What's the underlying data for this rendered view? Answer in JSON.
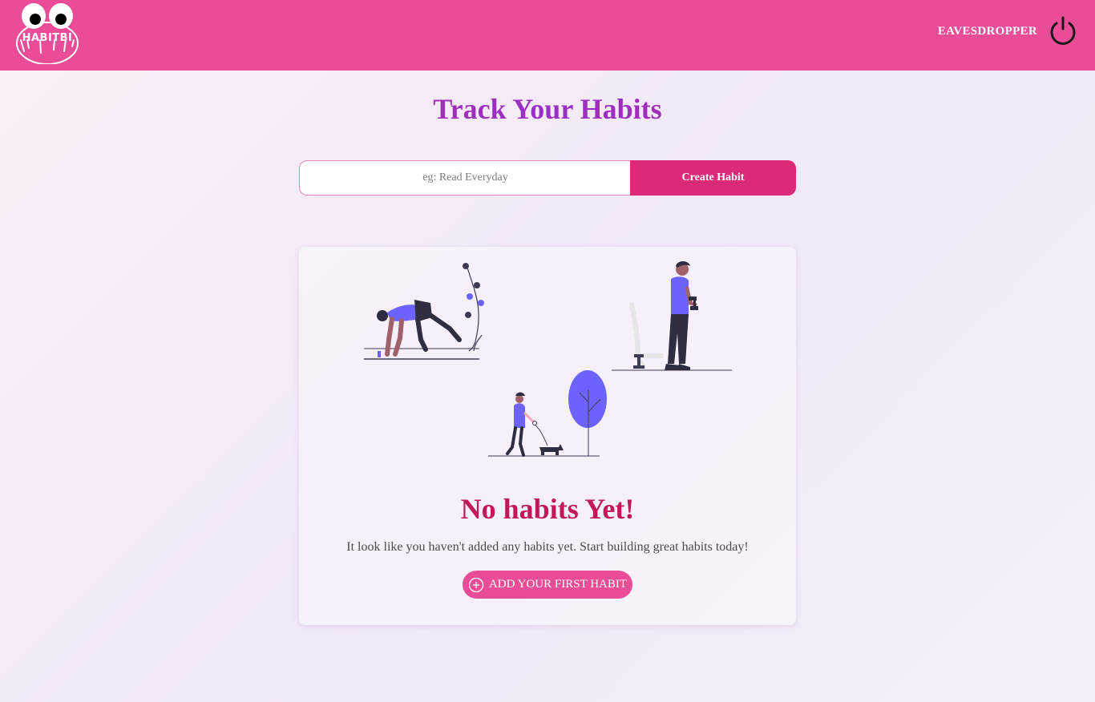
{
  "header": {
    "logo_text": "HABITBI",
    "username": "EAVESDROPPER",
    "logout_icon": "power-icon"
  },
  "main": {
    "title": "Track Your Habits",
    "habit_input": {
      "placeholder": "eg: Read Everyday",
      "value": ""
    },
    "create_button_label": "Create Habit"
  },
  "empty_state": {
    "illustration": "fitness-habits-illustration",
    "title": "No habits Yet!",
    "description": "It look like you haven't added any habits yet. Start building great habits today!",
    "add_button_label": "ADD YOUR FIRST HABIT",
    "add_button_icon": "plus-circle-icon"
  },
  "colors": {
    "header_bg": "#ea4c98",
    "primary_button": "#db2a78",
    "empty_title": "#c2185b",
    "illustration_accent": "#6c63ff"
  }
}
